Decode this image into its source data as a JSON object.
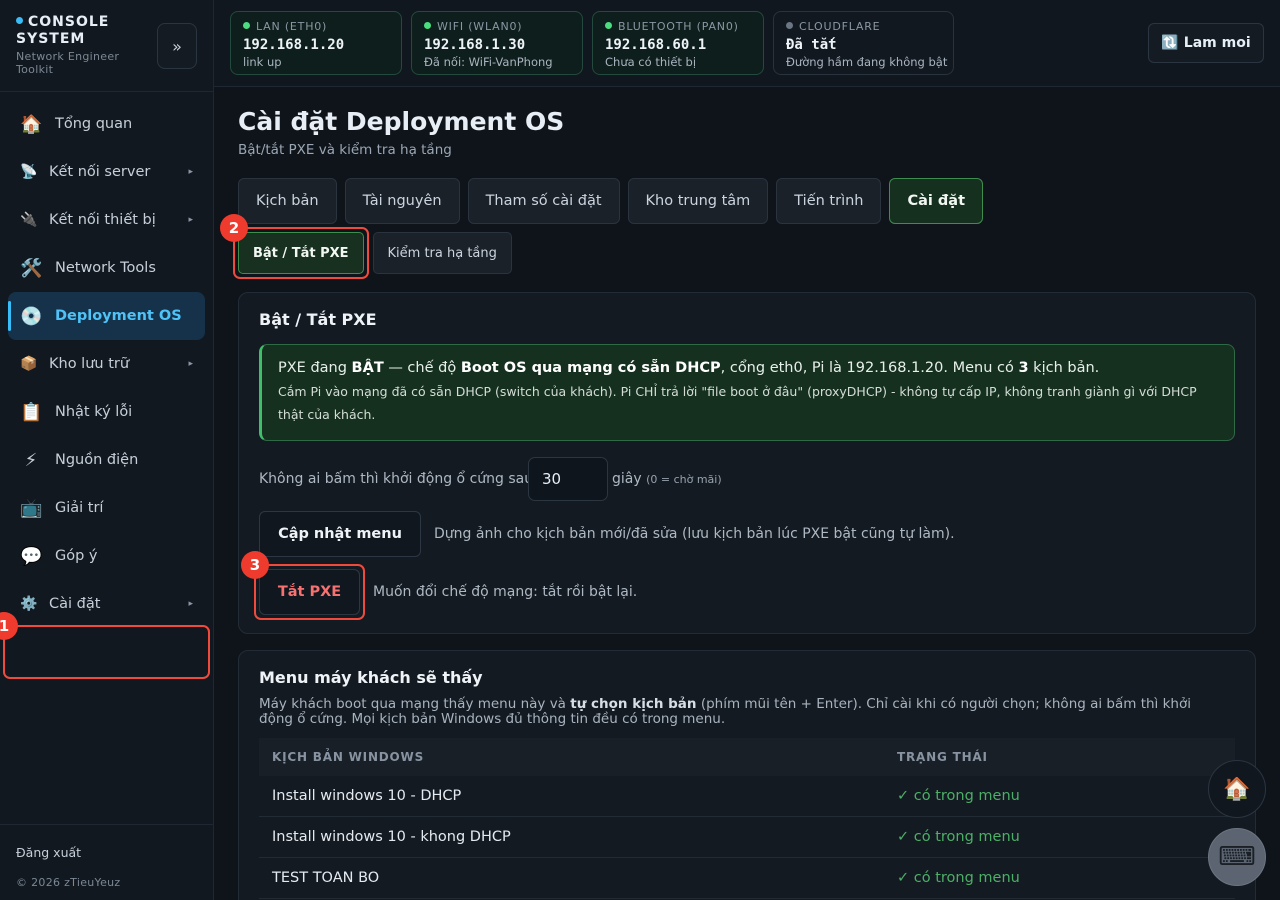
{
  "brand": {
    "title": "CONSOLE SYSTEM",
    "subtitle": "Network Engineer Toolkit",
    "collapse_icon": "»"
  },
  "sidebar": {
    "items": [
      {
        "icon": "🏠",
        "label": "Tổng quan"
      },
      {
        "icon": "📡",
        "label": "Kết nối server",
        "caret": "▸"
      },
      {
        "icon": "🔌",
        "label": "Kết nối thiết bị",
        "caret": "▸"
      },
      {
        "icon": "🛠️",
        "label": "Network Tools"
      },
      {
        "icon": "💿",
        "label": "Deployment OS"
      },
      {
        "icon": "📦",
        "label": "Kho lưu trữ",
        "caret": "▸"
      },
      {
        "icon": "📋",
        "label": "Nhật ký lỗi"
      },
      {
        "icon": "⚡",
        "label": "Nguồn điện"
      },
      {
        "icon": "📺",
        "label": "Giải trí"
      },
      {
        "icon": "💬",
        "label": "Góp ý"
      },
      {
        "icon": "⚙️",
        "label": "Cài đặt",
        "caret": "▸"
      }
    ],
    "logout": "Đăng xuất",
    "copyright": "© 2026 zTieuYeuz"
  },
  "markers": {
    "m1": "1",
    "m2": "2",
    "m3": "3"
  },
  "topbar": {
    "cards": [
      {
        "name": "LAN (ETH0)",
        "ip": "192.168.1.20",
        "status": "link up"
      },
      {
        "name": "WIFI (WLAN0)",
        "ip": "192.168.1.30",
        "status": "Đã nối: WiFi-VanPhong"
      },
      {
        "name": "BLUETOOTH (PAN0)",
        "ip": "192.168.60.1",
        "status": "Chưa có thiết bị"
      },
      {
        "name": "CLOUDFLARE",
        "ip": "Đã tắt",
        "status": "Đường hầm đang không bật"
      }
    ],
    "refresh_icon": "🔃",
    "refresh_label": "Lam moi",
    "colors": {
      "online": "#4ade80",
      "offline": "#6b7683"
    }
  },
  "page": {
    "title": "Cài đặt Deployment OS",
    "subtitle": "Bật/tắt PXE và kiểm tra hạ tầng",
    "tabs": [
      "Kịch bản",
      "Tài nguyên",
      "Tham số cài đặt",
      "Kho trung tâm",
      "Tiến trình",
      "Cài đặt"
    ],
    "subtabs": [
      "Bật / Tắt PXE",
      "Kiểm tra hạ tầng"
    ]
  },
  "pxe": {
    "title": "Bật / Tắt PXE",
    "alert": {
      "t1": "PXE đang ",
      "state": "BẬT",
      "t2": " — chế độ ",
      "mode": "Boot OS qua mạng có sẵn DHCP",
      "t3": ", cổng eth0, Pi là 192.168.1.20. Menu có ",
      "count": "3",
      "t4": " kịch bản.",
      "sub": "Cắm Pi vào mạng đã có sẵn DHCP (switch của khách). Pi CHỈ trả lời \"file boot ở đâu\" (proxyDHCP) - không tự cấp IP, không tranh giành gì với DHCP thật của khách."
    },
    "timeout_label": "Không ai bấm thì khởi động ổ cứng sau",
    "timeout_value": "30",
    "timeout_unit": "giây",
    "timeout_note": "(0 = chờ mãi)",
    "update_btn": "Cập nhật menu",
    "update_hint": "Dựng ảnh cho kịch bản mới/đã sửa (lưu kịch bản lúc PXE bật cũng tự làm).",
    "off_btn": "Tắt PXE",
    "off_hint": "Muốn đổi chế độ mạng: tắt rồi bật lại."
  },
  "menu": {
    "title": "Menu máy khách sẽ thấy",
    "desc1": "Máy khách boot qua mạng thấy menu này và ",
    "desc_bold": "tự chọn kịch bản",
    "desc2": " (phím mũi tên + Enter). Chỉ cài khi có người chọn; không ai bấm thì khởi động ổ cứng. Mọi kịch bản Windows đủ thông tin đều có trong menu.",
    "headers": [
      "KỊCH BẢN WINDOWS",
      "TRẠNG THÁI"
    ],
    "rows": [
      {
        "name": "Install windows 10 - DHCP",
        "status": "✓ có trong menu"
      },
      {
        "name": "Install windows 10 - khong DHCP",
        "status": "✓ có trong menu"
      },
      {
        "name": "TEST TOAN BO",
        "status": "✓ có trong menu"
      }
    ]
  },
  "fabs": {
    "home_icon": "🏠",
    "keyboard_icon": "⌨"
  }
}
